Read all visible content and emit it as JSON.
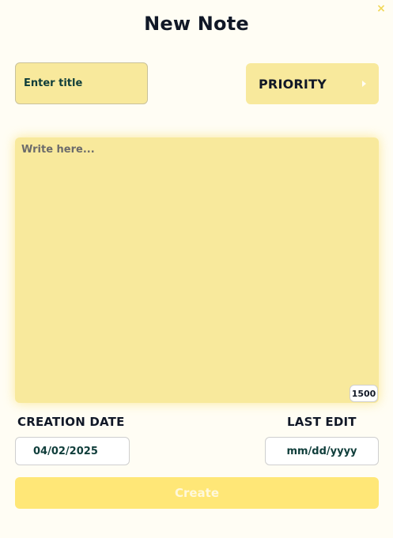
{
  "dialog": {
    "title": "New Note",
    "close_label": "×"
  },
  "form": {
    "title_placeholder": "Enter title",
    "priority_label": "PRIORITY",
    "note_placeholder": "Write here...",
    "char_count": "1500",
    "creation_date_label": "CREATION DATE",
    "creation_date_value": "04/02/2025",
    "last_edit_label": "LAST EDIT",
    "last_edit_value": "mm/dd/yyyy",
    "create_label": "Create"
  },
  "icons": {
    "close": "close-icon",
    "priority_chevron": "chevron-right-icon"
  },
  "colors": {
    "page_bg": "#fffdf4",
    "field_bg": "#f8e99c",
    "button_bg": "#ffe777",
    "button_text": "#fff8dc",
    "close_icon": "#f1d85a",
    "text_dark": "#111827",
    "input_text": "#0f3d3a"
  }
}
